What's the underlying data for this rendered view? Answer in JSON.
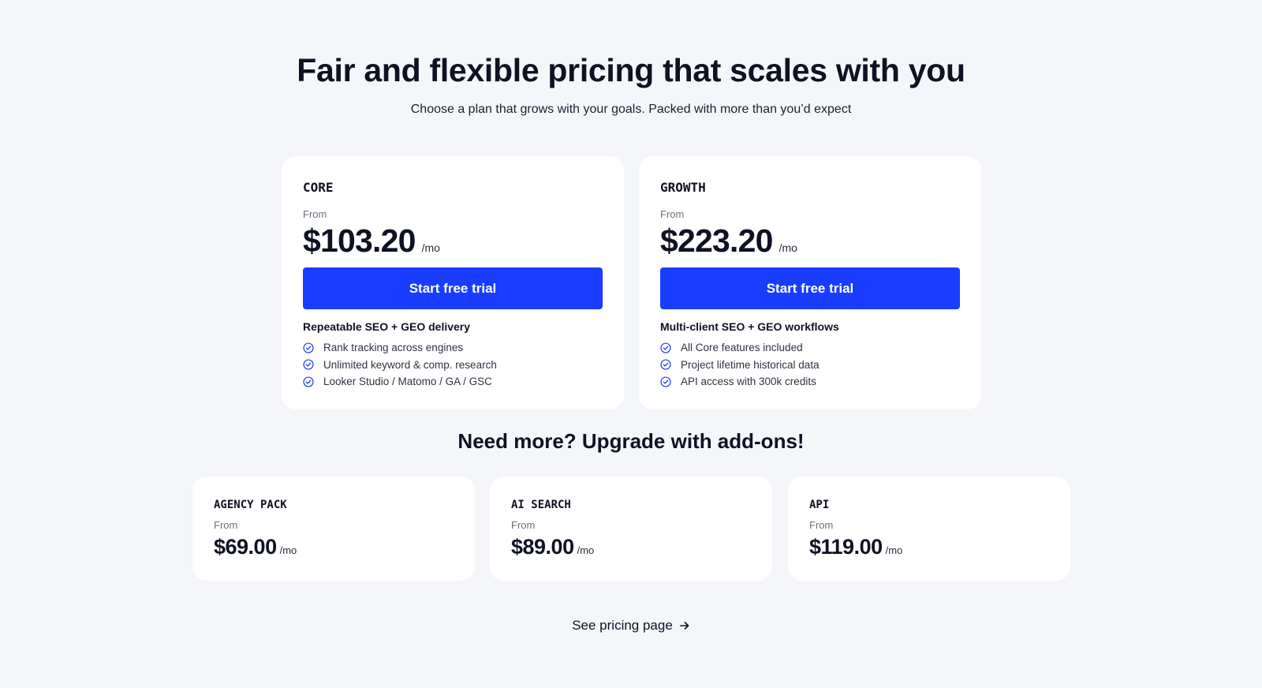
{
  "hero": {
    "title": "Fair and flexible pricing that scales with you",
    "subtitle": "Choose a plan that grows with your goals. Packed with more than you’d expect"
  },
  "plans": [
    {
      "name": "CORE",
      "from_label": "From",
      "price": "$103.20",
      "period": "/mo",
      "cta_label": "Start free trial",
      "features_title": "Repeatable SEO + GEO delivery",
      "features": [
        "Rank tracking across engines",
        "Unlimited keyword & comp. research",
        "Looker Studio / Matomo / GA / GSC"
      ]
    },
    {
      "name": "GROWTH",
      "from_label": "From",
      "price": "$223.20",
      "period": "/mo",
      "cta_label": "Start free trial",
      "features_title": "Multi-client SEO + GEO workflows",
      "features": [
        "All Core features included",
        "Project lifetime historical data",
        "API access with 300k credits"
      ]
    }
  ],
  "addons": {
    "title": "Need more? Upgrade with add-ons!",
    "items": [
      {
        "name": "AGENCY PACK",
        "from_label": "From",
        "price": "$69.00",
        "period": "/mo"
      },
      {
        "name": "AI SEARCH",
        "from_label": "From",
        "price": "$89.00",
        "period": "/mo"
      },
      {
        "name": "API",
        "from_label": "From",
        "price": "$119.00",
        "period": "/mo"
      }
    ]
  },
  "footer_link": {
    "label": "See pricing page",
    "icon": "arrow-right-icon"
  },
  "colors": {
    "accent": "#1a3cff",
    "background": "#f5f6fa",
    "card": "#ffffff",
    "text": "#0f1222"
  }
}
